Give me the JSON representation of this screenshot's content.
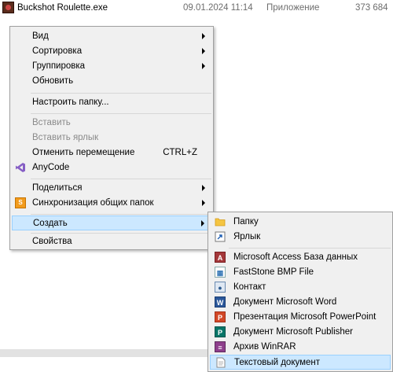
{
  "file": {
    "name": "Buckshot Roulette.exe",
    "date": "09.01.2024 11:14",
    "type": "Приложение",
    "size": "373 684"
  },
  "menu": {
    "view": "Вид",
    "sort": "Сортировка",
    "group": "Группировка",
    "refresh": "Обновить",
    "customize": "Настроить папку...",
    "paste": "Вставить",
    "paste_shortcut": "Вставить ярлык",
    "undo_move": "Отменить перемещение",
    "undo_shortcut": "CTRL+Z",
    "anycode": "AnyCode",
    "share": "Поделиться",
    "sync": "Синхронизация общих папок",
    "create": "Создать",
    "properties": "Свойства"
  },
  "submenu": {
    "folder": "Папку",
    "shortcut": "Ярлык",
    "access": "Microsoft Access База данных",
    "bmp": "FastStone BMP File",
    "contact": "Контакт",
    "word": "Документ Microsoft Word",
    "ppt": "Презентация Microsoft PowerPoint",
    "publisher": "Документ Microsoft Publisher",
    "winrar": "Архив WinRAR",
    "text": "Текстовый документ"
  },
  "colors": {
    "highlight": "#cce8ff",
    "highlight_border": "#99d1ff",
    "menu_bg": "#f0f0f0"
  },
  "icons": {
    "anycode": "visual-studio-icon",
    "sync": "sync-icon",
    "folder": "folder-icon",
    "shortcut": "shortcut-icon",
    "access": "access-icon",
    "bmp": "bmp-icon",
    "contact": "contact-icon",
    "word": "word-icon",
    "ppt": "powerpoint-icon",
    "publisher": "publisher-icon",
    "winrar": "winrar-icon",
    "text": "text-document-icon"
  }
}
